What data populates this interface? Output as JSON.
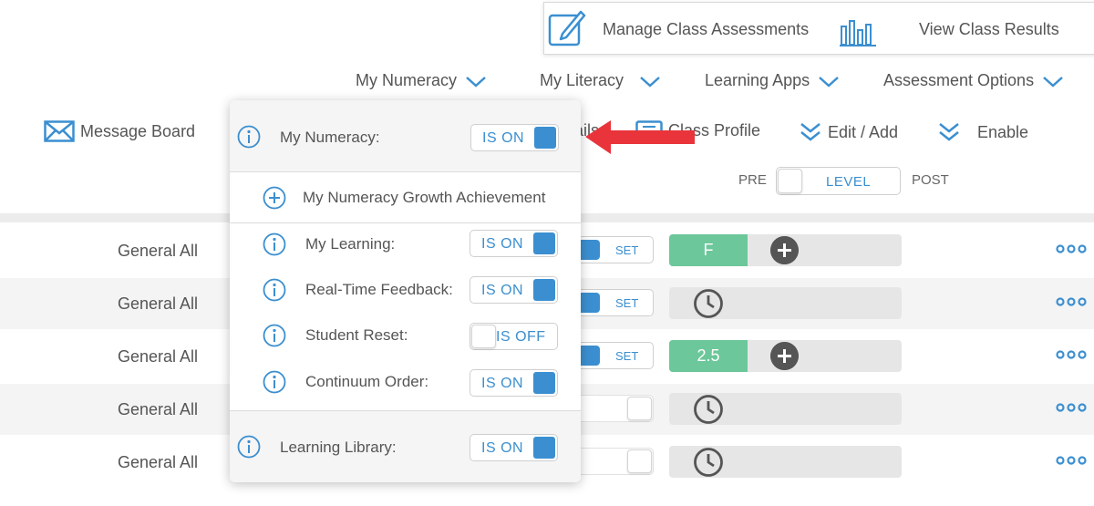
{
  "top_actions": {
    "manage_label": "Manage Class Assessments",
    "results_label": "View Class Results"
  },
  "nav": {
    "numeracy": "My Numeracy",
    "literacy": "My Literacy",
    "apps": "Learning Apps",
    "assessment": "Assessment Options"
  },
  "toolbar": {
    "message_board": "Message Board",
    "details_fragment": "ails",
    "class_profile": "Class Profile",
    "edit_add": "Edit / Add",
    "enable": "Enable"
  },
  "level_switch": {
    "pre": "PRE",
    "value": "LEVEL",
    "post": "POST"
  },
  "rows": [
    {
      "name": "General All",
      "control": "SET",
      "grade": "F"
    },
    {
      "name": "General All",
      "control": "SET",
      "grade": ""
    },
    {
      "name": "General All",
      "control": "SET",
      "grade": "2.5"
    },
    {
      "name": "General All",
      "control": "",
      "grade": ""
    },
    {
      "name": "General All",
      "control": "",
      "grade": ""
    }
  ],
  "popup": {
    "header": {
      "label": "My Numeracy:",
      "state": "IS ON"
    },
    "growth": "My Numeracy Growth Achievement",
    "items": [
      {
        "label": "My Learning:",
        "state": "IS ON"
      },
      {
        "label": "Real-Time Feedback:",
        "state": "IS ON"
      },
      {
        "label": "Student Reset:",
        "state": "IS OFF"
      },
      {
        "label": "Continuum Order:",
        "state": "IS ON"
      }
    ],
    "footer": {
      "label": "Learning Library:",
      "state": "IS ON"
    }
  },
  "colors": {
    "accent": "#3b8fd0",
    "grade_green": "#6cc79a",
    "arrow_red": "#e8343a"
  }
}
